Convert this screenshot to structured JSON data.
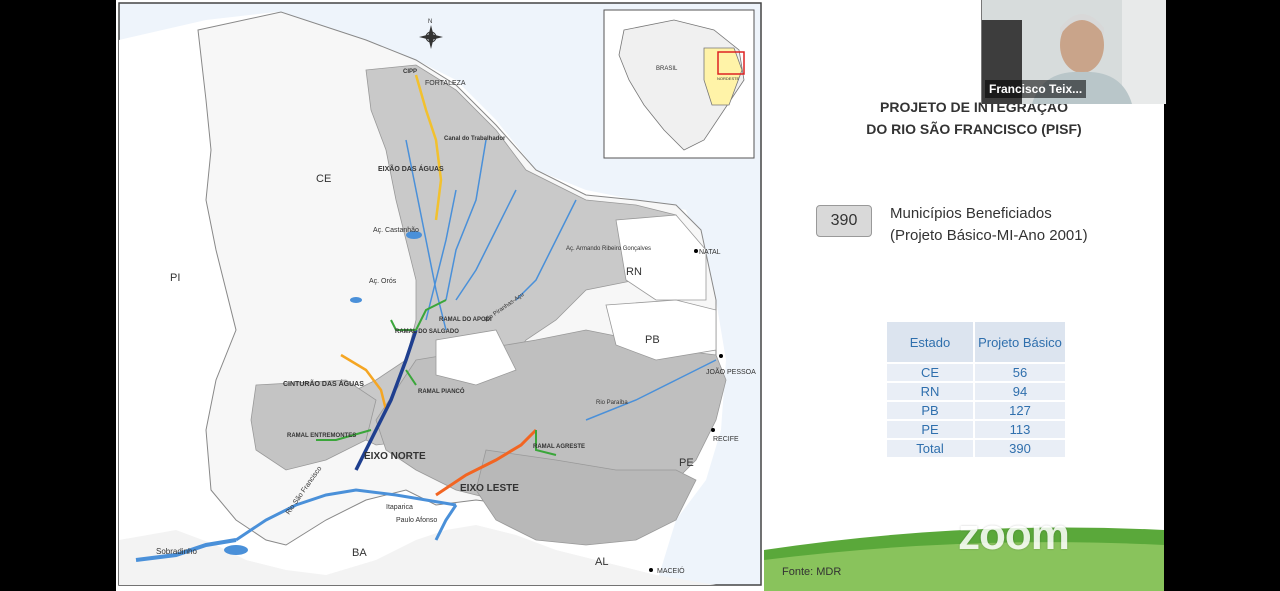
{
  "slide": {
    "title_line1": "PROJETO DE INTEGRAÇÃO",
    "title_line2": "DO RIO SÃO FRANCISCO (PISF)",
    "badge_value": "390",
    "badge_text_line1": "Municípios Beneficiados",
    "badge_text_line2": "(Projeto Básico-MI-Ano 2001)",
    "table": {
      "headers": [
        "Estado",
        "Projeto Básico"
      ],
      "rows": [
        [
          "CE",
          "56"
        ],
        [
          "RN",
          "94"
        ],
        [
          "PB",
          "127"
        ],
        [
          "PE",
          "113"
        ],
        [
          "Total",
          "390"
        ]
      ]
    },
    "source": "Fonte: MDR",
    "zoom_watermark": "zoom"
  },
  "map": {
    "states": [
      "CE",
      "PI",
      "RN",
      "PB",
      "PE",
      "BA",
      "AL"
    ],
    "cities": [
      "FORTALEZA",
      "NATAL",
      "JOÃO PESSOA",
      "RECIFE",
      "MACEIÓ"
    ],
    "features": [
      "CIPP",
      "Canal do Trabalhador",
      "EIXÃO DAS ÁGUAS",
      "Aç. Castanhão",
      "Aç. Orós",
      "RAMAL DO APODI",
      "RAMAL DO SALGADO",
      "CINTURÃO DAS ÁGUAS",
      "RAMAL PIANCÓ",
      "RAMAL ENTREMONTES",
      "RAMAL AGRESTE",
      "EIXO NORTE",
      "EIXO LESTE",
      "Rio São Francisco",
      "Sobradinho",
      "Itaparica",
      "Paulo Afonso",
      "Aç. Armando Ribeiro Gonçalves",
      "Rio Paraíba",
      "Rio Piranhas-Açu"
    ],
    "inset_labels": [
      "BRASIL",
      "NORDESTE"
    ],
    "compass_letter": "N",
    "colors": {
      "eixo_norte": "#1f3f8f",
      "eixo_leste": "#f26522",
      "eixao": "#f2c12e",
      "ramais": "#3aa63a",
      "cinturao": "#f5a623",
      "rivers": "#4a90d9",
      "region": "#c8c8c8"
    }
  },
  "video": {
    "participant_name": "Francisco Teix..."
  }
}
